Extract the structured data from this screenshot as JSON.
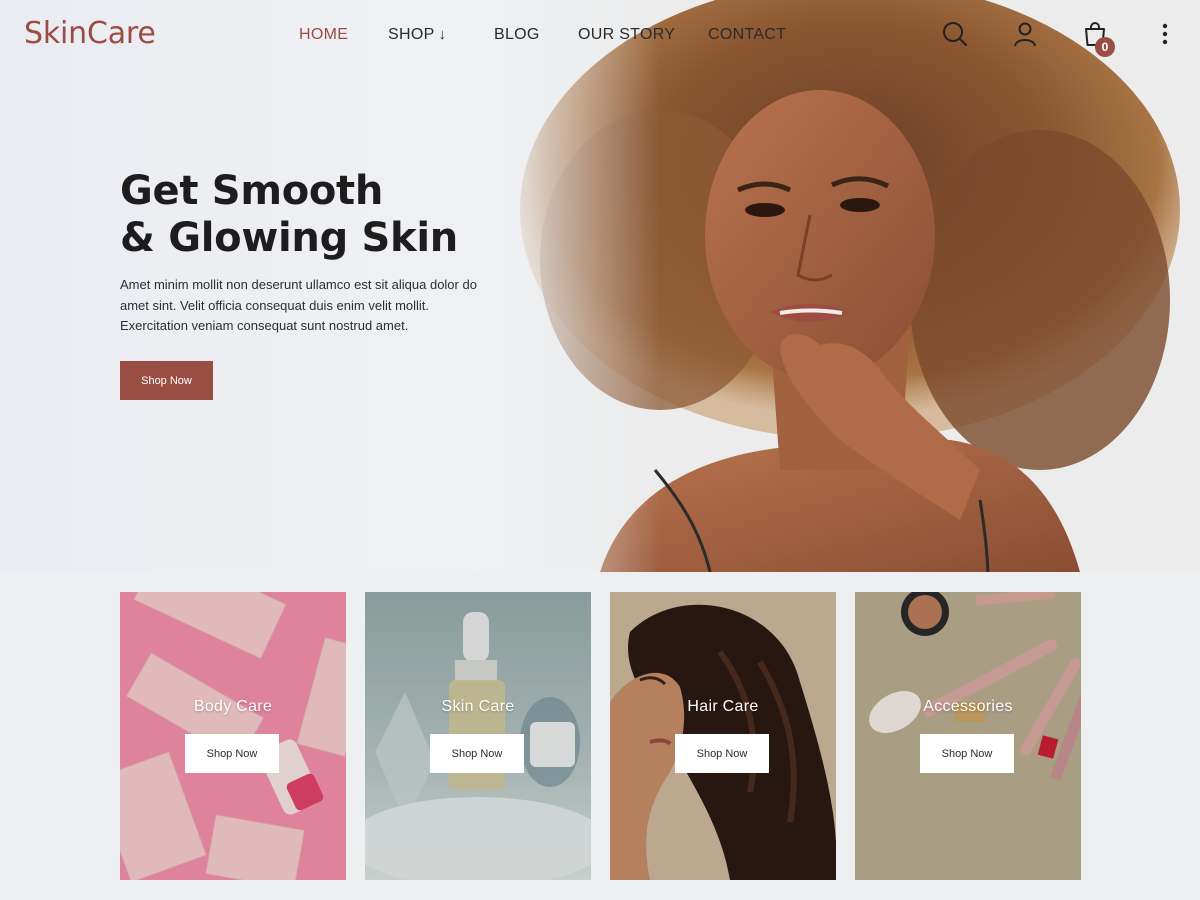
{
  "brand": {
    "logo": "SkinCare",
    "accent_color": "#9a4e43"
  },
  "nav": {
    "items": [
      {
        "label": "HOME",
        "active": true
      },
      {
        "label": "SHOP",
        "has_dropdown": true,
        "dropdown_icon": "arrow-down-icon"
      },
      {
        "label": "BLOG"
      },
      {
        "label": "OUR STORY"
      },
      {
        "label": "CONTACT"
      }
    ],
    "icons": [
      "search-icon",
      "user-icon",
      "cart-icon",
      "more-vertical-icon"
    ],
    "cart_count": "0"
  },
  "hero": {
    "title_line1": "Get Smooth",
    "title_line2": "& Glowing Skin",
    "description": "Amet minim mollit non deserunt ullamco est sit aliqua dolor do amet sint. Velit officia consequat duis enim velit mollit. Exercitation veniam consequat sunt nostrud amet.",
    "cta_label": "Shop Now"
  },
  "categories": [
    {
      "title": "Body Care",
      "button": "Shop Now",
      "color": "#f08aa8"
    },
    {
      "title": "Skin Care",
      "button": "Shop Now",
      "color": "#9fb4b2"
    },
    {
      "title": "Hair Care",
      "button": "Shop Now",
      "color": "#c7b59d"
    },
    {
      "title": "Accessories",
      "button": "Shop Now",
      "color": "#b9ad91"
    }
  ]
}
